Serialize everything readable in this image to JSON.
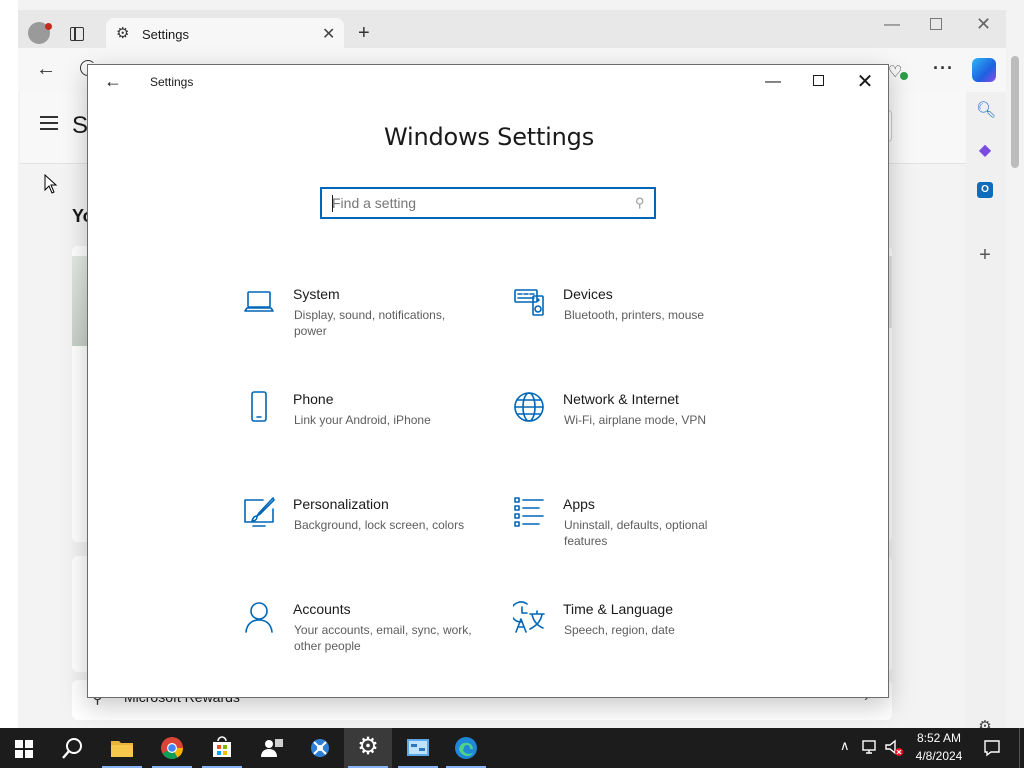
{
  "browser": {
    "tab_title": "Settings",
    "page_brand": "Se",
    "greeting": "Yo",
    "rewards_label": "Microsoft Rewards"
  },
  "settings_window": {
    "title": "Settings",
    "heading": "Windows Settings",
    "search": {
      "placeholder": "Find a setting",
      "value": ""
    },
    "categories": [
      {
        "name": "System",
        "description": "Display, sound, notifications, power",
        "icon": "laptop-icon"
      },
      {
        "name": "Devices",
        "description": "Bluetooth, printers, mouse",
        "icon": "devices-icon"
      },
      {
        "name": "Phone",
        "description": "Link your Android, iPhone",
        "icon": "phone-icon"
      },
      {
        "name": "Network & Internet",
        "description": "Wi-Fi, airplane mode, VPN",
        "icon": "globe-icon"
      },
      {
        "name": "Personalization",
        "description": "Background, lock screen, colors",
        "icon": "paintbrush-icon"
      },
      {
        "name": "Apps",
        "description": "Uninstall, defaults, optional features",
        "icon": "apps-list-icon"
      },
      {
        "name": "Accounts",
        "description": "Your accounts, email, sync, work, other people",
        "icon": "person-icon"
      },
      {
        "name": "Time & Language",
        "description": "Speech, region, date",
        "icon": "time-language-icon"
      }
    ],
    "accent_color": "#0067b8"
  },
  "taskbar": {
    "apps": [
      "start-icon",
      "search-icon",
      "file-explorer-icon",
      "chrome-icon",
      "store-icon",
      "people-icon",
      "tool-icon",
      "settings-gear-icon",
      "control-panel-icon",
      "edge-icon"
    ],
    "clock": {
      "time": "8:52 AM",
      "date": "4/8/2024"
    }
  }
}
